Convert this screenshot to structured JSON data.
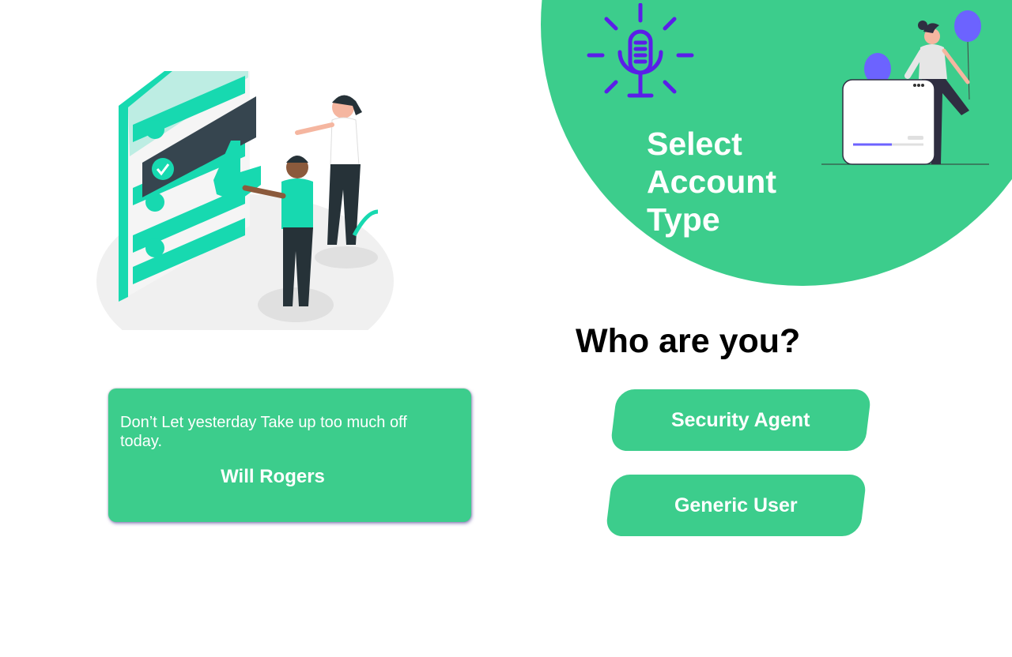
{
  "hero": {
    "title_lines": [
      "Select",
      "Account",
      "Type"
    ]
  },
  "prompt": {
    "question": "Who are you?"
  },
  "account_types": [
    {
      "label": "Security Agent"
    },
    {
      "label": "Generic User"
    }
  ],
  "quote": {
    "text": "Don’t Let yesterday Take up too much off today.",
    "author": "Will Rogers"
  },
  "icons": {
    "logo": "microphone-bulb-icon"
  },
  "colors": {
    "brand_green": "#3ccd8c",
    "logo_purple": "#5b1ee8",
    "balloon_purple": "#6c63ff",
    "accent_teal": "#17d9b0"
  }
}
